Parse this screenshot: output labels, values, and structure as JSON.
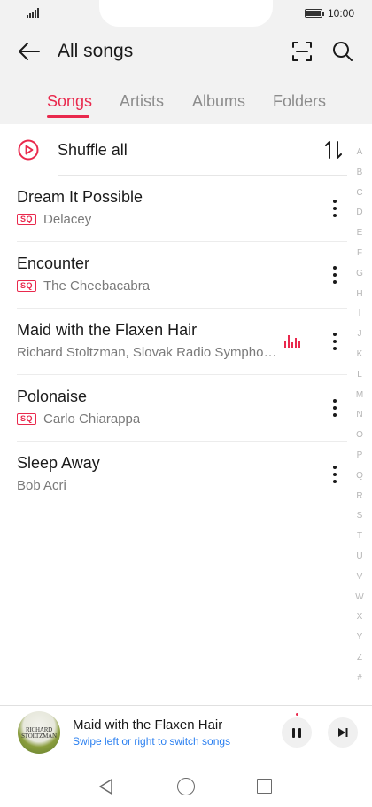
{
  "status_bar": {
    "time": "10:00"
  },
  "header": {
    "title": "All songs",
    "back_icon": "arrow-left-icon",
    "scan_icon": "scan-icon",
    "search_icon": "search-icon"
  },
  "tabs": [
    {
      "label": "Songs",
      "active": true
    },
    {
      "label": "Artists",
      "active": false
    },
    {
      "label": "Albums",
      "active": false
    },
    {
      "label": "Folders",
      "active": false
    }
  ],
  "shuffle": {
    "label": "Shuffle all",
    "icon": "play-circle-icon",
    "sort_icon": "sort-arrows-icon"
  },
  "songs": [
    {
      "title": "Dream It Possible",
      "artist": "Delacey",
      "badge": "SQ",
      "playing": false
    },
    {
      "title": "Encounter",
      "artist": "The Cheebacabra",
      "badge": "SQ",
      "playing": false
    },
    {
      "title": "Maid with the Flaxen Hair",
      "artist": "Richard Stoltzman, Slovak Radio Symphon…",
      "badge": "",
      "playing": true
    },
    {
      "title": "Polonaise",
      "artist": "Carlo Chiarappa",
      "badge": "SQ",
      "playing": false
    },
    {
      "title": "Sleep Away",
      "artist": "Bob Acri",
      "badge": "",
      "playing": false
    }
  ],
  "alphabet_index": [
    "A",
    "B",
    "C",
    "D",
    "E",
    "F",
    "G",
    "H",
    "I",
    "J",
    "K",
    "L",
    "M",
    "N",
    "O",
    "P",
    "Q",
    "R",
    "S",
    "T",
    "U",
    "V",
    "W",
    "X",
    "Y",
    "Z",
    "#"
  ],
  "now_playing": {
    "title": "Maid with the Flaxen Hair",
    "hint": "Swipe left or right to switch songs",
    "album_art_text": "RICHARD STOLTZMAN",
    "pause_icon": "pause-icon",
    "next_icon": "skip-next-icon"
  },
  "colors": {
    "accent": "#e9294d",
    "hint": "#2a7ff0",
    "header_bg": "#f2f2f2"
  }
}
